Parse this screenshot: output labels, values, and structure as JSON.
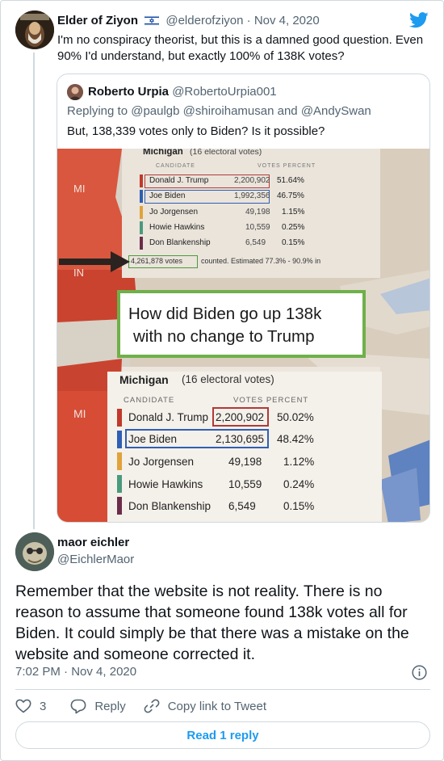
{
  "parent_tweet": {
    "author_name": "Elder of Ziyon",
    "handle": "@elderofziyon",
    "separator": "·",
    "date": "Nov 4, 2020",
    "text": "I'm no conspiracy theorist, but this is a damned good question. Even 90% I'd understand, but exactly 100% of 138K votes?",
    "icons": {
      "flag": "israel-flag-icon",
      "logo": "twitter-bird-icon"
    },
    "accent_color": "#1d9bf0"
  },
  "quoted_tweet": {
    "author_name": "Roberto Urpia",
    "handle": "@RobertoUrpia001",
    "replying_prefix": "Replying to",
    "replying_to": [
      "@paulgb",
      "@shiroihamusan",
      "and",
      "@AndySwan"
    ],
    "text": "But, 138,339 votes only to Biden? Is it possible?",
    "photo": {
      "state_label_mi": "MI",
      "state_label_in": "IN",
      "top_table": {
        "title": "Michigan",
        "subtitle": "(16 electoral votes)",
        "col_candidate": "CANDIDATE",
        "col_votes": "VOTES PERCENT",
        "rows": [
          {
            "name": "Donald J. Trump",
            "votes": "2,200,902",
            "pct": "51.64%"
          },
          {
            "name": "Joe Biden",
            "votes": "1,992,356",
            "pct": "46.75%"
          },
          {
            "name": "Jo Jorgensen",
            "votes": "49,198",
            "pct": "1.15%"
          },
          {
            "name": "Howie Hawkins",
            "votes": "10,559",
            "pct": "0.25%"
          },
          {
            "name": "Don Blankenship",
            "votes": "6,549",
            "pct": "0.15%"
          }
        ],
        "total_votes": "4,261,878 votes",
        "total_rest": "counted. Estimated 77.3% - 90.9% in"
      },
      "caption_line1": "How did Biden go up 138k",
      "caption_line2": "with no change to Trump",
      "bottom_table": {
        "title": "Michigan",
        "subtitle": "(16 electoral votes)",
        "col_candidate": "CANDIDATE",
        "col_votes": "VOTES PERCENT",
        "rows": [
          {
            "name": "Donald J. Trump",
            "votes": "2,200,902",
            "pct": "50.02%"
          },
          {
            "name": "Joe Biden",
            "votes": "2,130,695",
            "pct": "48.42%"
          },
          {
            "name": "Jo Jorgensen",
            "votes": "49,198",
            "pct": "1.12%"
          },
          {
            "name": "Howie Hawkins",
            "votes": "10,559",
            "pct": "0.24%"
          },
          {
            "name": "Don Blankenship",
            "votes": "6,549",
            "pct": "0.15%"
          }
        ]
      }
    }
  },
  "reply_tweet": {
    "author_name": "maor eichler",
    "handle": "@EichlerMaor",
    "text": "Remember that the website is not reality. There is no reason to assume that someone found 138k votes all for Biden. It could simply be that there was a mistake on the website and someone corrected it.",
    "time": "7:02 PM",
    "separator": "·",
    "date": "Nov 4, 2020",
    "actions": {
      "like_count": "3",
      "reply_label": "Reply",
      "copy_link_label": "Copy link to Tweet"
    },
    "read_replies_label": "Read 1 reply"
  }
}
